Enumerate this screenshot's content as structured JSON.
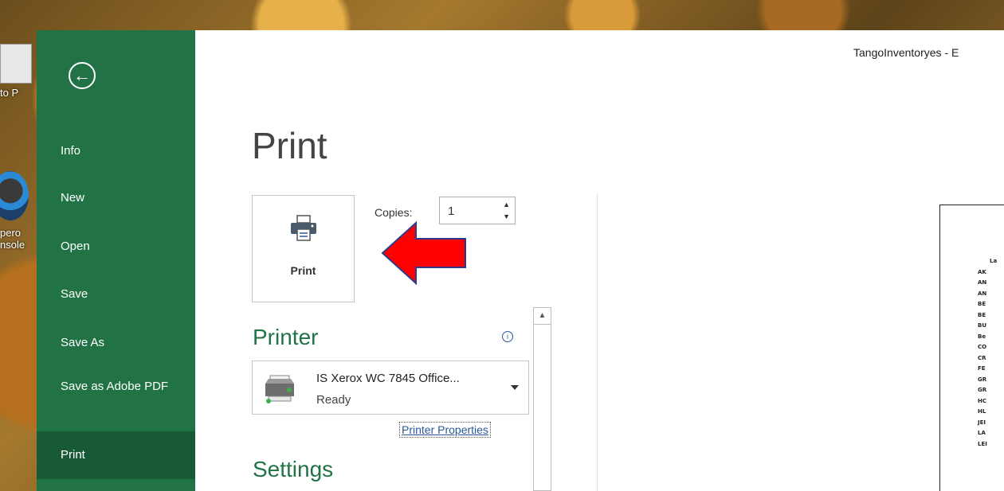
{
  "window": {
    "title": "TangoInventoryes - E"
  },
  "desktop_icons": [
    {
      "label": "to P",
      "icon": "file-icon"
    },
    {
      "label": "pero",
      "sublabel": "nsole",
      "icon": "orb-icon"
    }
  ],
  "backstage": {
    "back_icon": "back-arrow-icon",
    "items": [
      {
        "label": "Info"
      },
      {
        "label": "New"
      },
      {
        "label": "Open"
      },
      {
        "label": "Save"
      },
      {
        "label": "Save As"
      },
      {
        "label": "Save as Adobe PDF"
      },
      {
        "label": "Print",
        "active": true
      }
    ]
  },
  "print_panel": {
    "title": "Print",
    "print_button_label": "Print",
    "copies_label": "Copies:",
    "copies_value": "1",
    "printer_section_title": "Printer",
    "printer_name": "IS Xerox WC 7845 Office...",
    "printer_status": "Ready",
    "printer_properties_link": "Printer Properties",
    "settings_section_title": "Settings",
    "info_icon": "info-icon"
  },
  "annotation": {
    "color": "#ff0000",
    "outline": "#2b3a8f"
  },
  "preview_lines": [
    "La",
    "AK",
    "AN",
    "AN",
    "BE",
    "BE",
    "BU",
    "Be",
    "CO",
    "CR",
    "FE",
    "GR",
    "GR",
    "HC",
    "HL",
    "JEI",
    "LA",
    "LEI"
  ],
  "colors": {
    "accent": "#217346",
    "active_nav": "#195a36",
    "link": "#2b579a"
  }
}
